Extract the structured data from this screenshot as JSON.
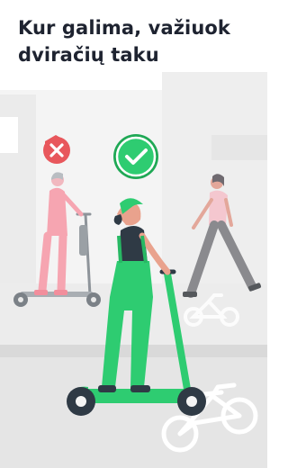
{
  "heading": {
    "line1": "Kur galima, važiuok",
    "line2": "dviračių taku"
  },
  "illustration": {
    "status_icons": [
      "close-icon",
      "check-icon"
    ],
    "colors": {
      "background": "#f4f4f4",
      "sidewalk": "#ececec",
      "road": "#e5e5e5",
      "curb": "#d9d9d9",
      "bike_lane_marking": "#ffffff",
      "accent_green": "#2ecc71",
      "check_circle_ring": "#1fa855",
      "forbidden_red": "#e8575c",
      "forbidden_person": "#f6a5b1",
      "pedestrian_pants": "#8a8a8e",
      "pedestrian_shirt": "#f4c7cf",
      "scooter_dark": "#2f3a45",
      "text_dark": "#1e2330"
    }
  }
}
